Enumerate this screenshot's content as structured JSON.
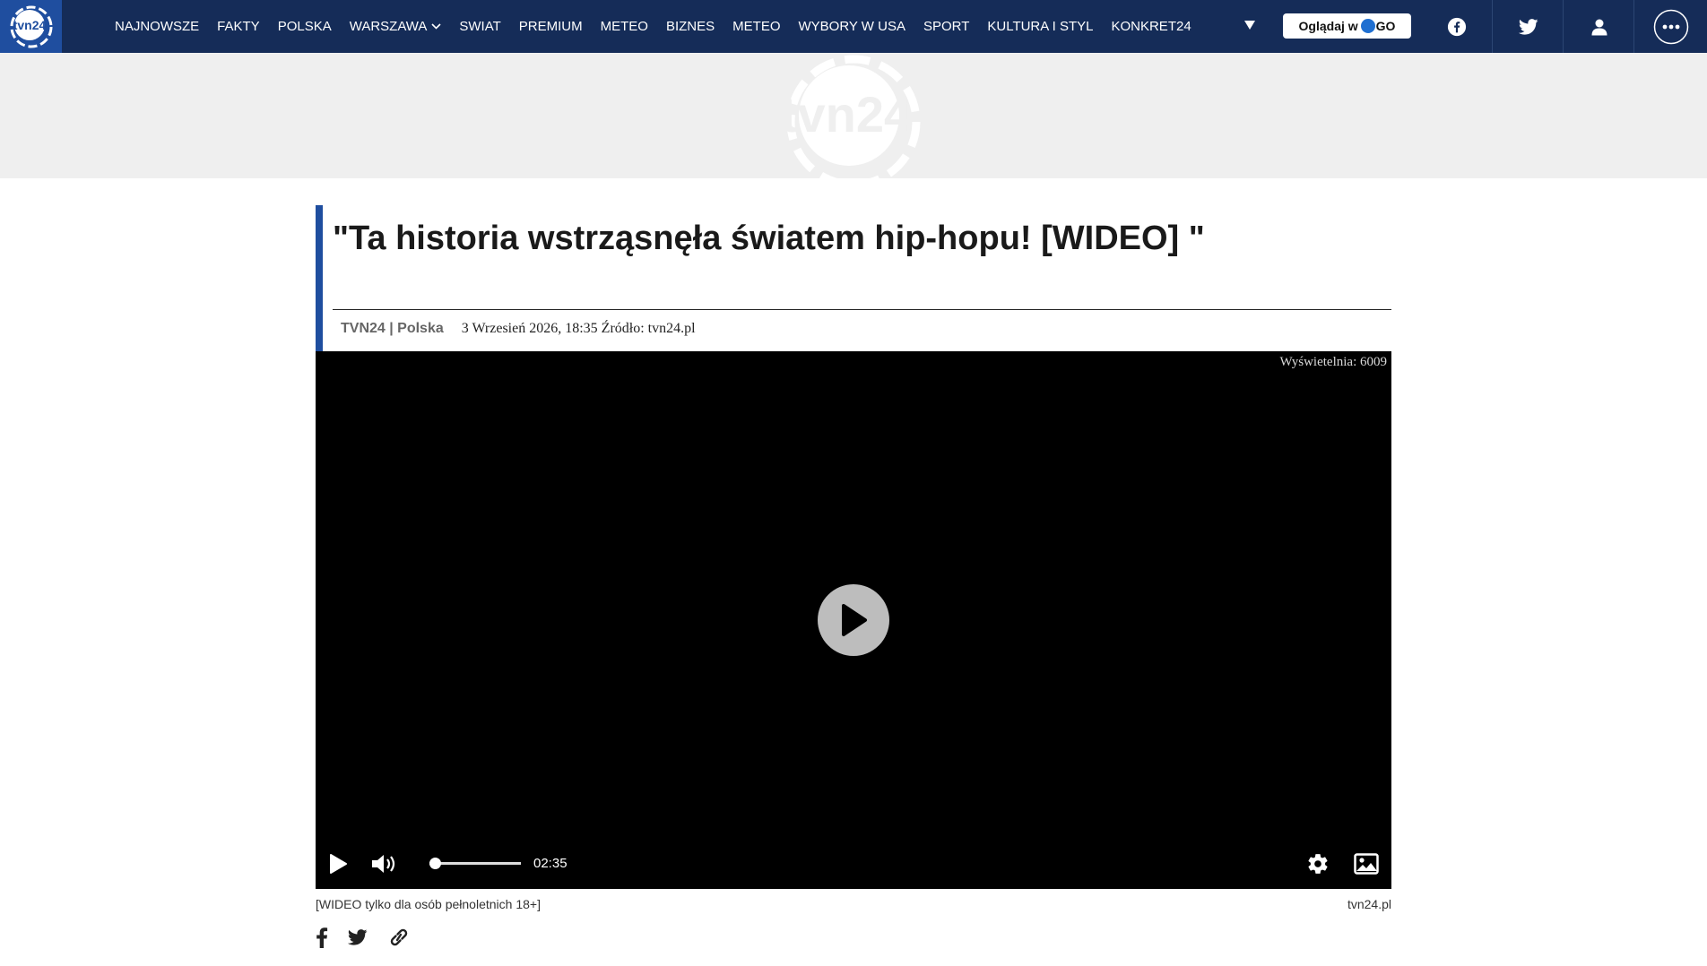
{
  "nav": {
    "logo_text": "tvn24",
    "items": [
      {
        "label": "NAJNOWSZE"
      },
      {
        "label": "FAKTY"
      },
      {
        "label": "POLSKA"
      },
      {
        "label": "WARSZAWA"
      },
      {
        "label": "SWIAT"
      },
      {
        "label": "PREMIUM"
      },
      {
        "label": "METEO"
      },
      {
        "label": "BIZNES"
      },
      {
        "label": "METEO"
      },
      {
        "label": "WYBORY W USA"
      },
      {
        "label": "SPORT"
      },
      {
        "label": "KULTURA I STYL"
      },
      {
        "label": "KONKRET24"
      }
    ],
    "watch_label": "Oglądaj w",
    "watch_go": "GO"
  },
  "banner": {
    "logo_text": "tvn24"
  },
  "article": {
    "title": "\"Ta historia wstrząsnęła światem hip-hopu! [WIDEO] \"",
    "source": "TVN24 | Polska",
    "date_source": "3 Wrzesień 2026, 18:35 Źródło: tvn24.pl"
  },
  "player": {
    "views": "Wyświetelnia: 6009",
    "time": "02:35",
    "progress": 0.06
  },
  "caption": {
    "text": "[WIDEO tylko dla osób pełnoletnich 18+]",
    "source": "tvn24.pl"
  },
  "colors": {
    "nav_bg": "#152c58",
    "accent": "#1f4e9f",
    "banner_bg": "#efefef",
    "player_bg": "#000000"
  }
}
